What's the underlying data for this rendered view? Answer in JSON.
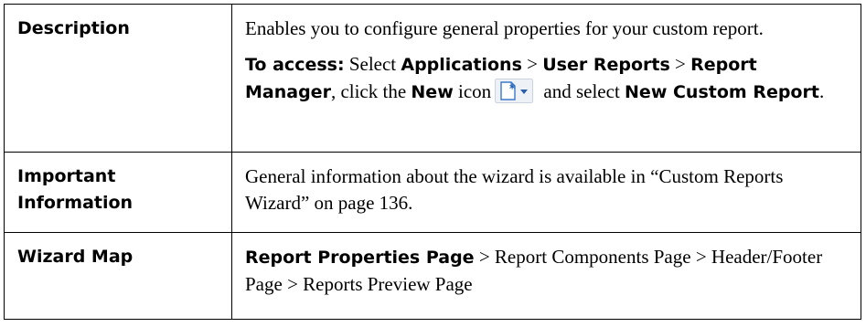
{
  "rows": [
    {
      "label": "Description",
      "text": "Enables you to configure general properties for your custom report.",
      "access": {
        "lead": "To access:",
        "select": "Select",
        "applications": "Applications",
        "sep1": ">",
        "user_reports": "User Reports",
        "sep2": ">",
        "report_manager": "Report Manager",
        "click_the": ", click the",
        "new": "New",
        "icon_word": "icon",
        "and_select": "and select",
        "new_custom_report": "New Custom Report",
        "end": ".",
        "icon_name": "new-item-dropdown-icon"
      }
    },
    {
      "label": "Important Information",
      "text": "General information about the wizard is available in “Custom Reports Wizard” on page 136."
    },
    {
      "label": "Wizard Map",
      "current_page": "Report Properties Page",
      "rest": " > Report Components Page > Header/Footer Page > Reports Preview Page"
    }
  ],
  "colors": {
    "border": "#000000",
    "icon_blue": "#2a6fd6",
    "icon_star": "#1e5fb4"
  }
}
